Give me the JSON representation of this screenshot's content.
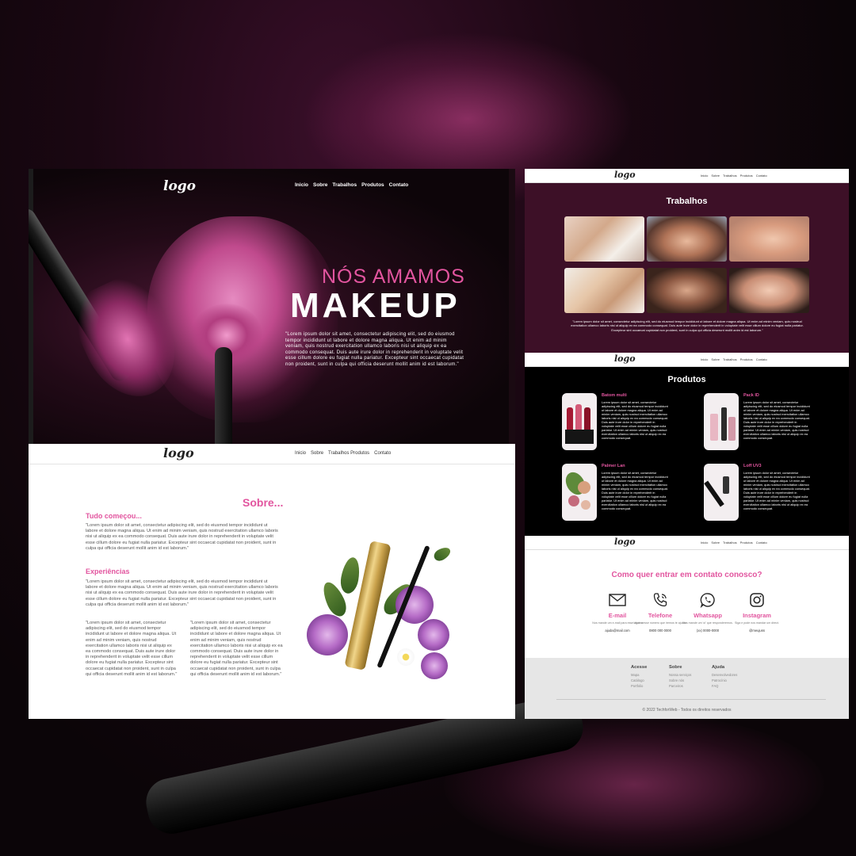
{
  "colors": {
    "accent": "#e2559f",
    "trabalhos_bg": "#3d1027",
    "produtos_bg": "#000000",
    "footer_bg": "#e6e6e6"
  },
  "hero": {
    "logo": "logo",
    "nav": [
      "Inicio",
      "Sobre",
      "Trabalhos",
      "Produtos",
      "Contato"
    ],
    "title_line1": "NÓS AMAMOS",
    "title_line2": "MAKEUP",
    "text": "\"Lorem ipsum dolor sit amet, consectetur adipiscing elit, sed do eiusmod tempor incididunt ut labore et dolore magna aliqua. Ut enim ad minim veniam, quis nostrud exercitation ullamco laboris nisi ut aliquip ex ea commodo consequat. Duis aute irure dolor in reprehenderit in voluptate velit esse cillum dolore eu fugiat nulla pariatur. Excepteur sint occaecat cupidatat non proident, sunt in culpa qui officia deserunt mollit anim id est laborum.\""
  },
  "navbar": {
    "logo": "logo",
    "links": [
      "Inicio",
      "Sobre",
      "Trabalhos Produtos",
      "Contato"
    ]
  },
  "sobre": {
    "title": "Sobre...",
    "heading1": "Tudo começou...",
    "para1": "\"Lorem ipsum dolor sit amet, consectetur adipiscing elit, sed do eiusmod tempor incididunt ut labore et dolore magna aliqua. Ut enim ad minim veniam, quis nostrud exercitation ullamco laboris nisi ut aliquip ex ea commodo consequat. Duis aute irure dolor in reprehenderit in voluptate velit esse cillum dolore eu fugiat nulla pariatur. Excepteur sint occaecat cupidatat non proident, sunt in culpa qui officia deserunt mollit anim id est laborum.\"",
    "heading2": "Experiências",
    "para2": "\"Lorem ipsum dolor sit amet, consectetur adipiscing elit, sed do eiusmod tempor incididunt ut labore et dolore magna aliqua. Ut enim ad minim veniam, quis nostrud exercitation ullamco laboris nisi ut aliquip ex ea commodo consequat. Duis aute irure dolor in reprehenderit in voluptate velit esse cillum dolore eu fugiat nulla pariatur. Excepteur sint occaecat cupidatat non proident, sunt in culpa qui officia deserunt mollit anim id est laborum.\"",
    "para3": "\"Lorem ipsum dolor sit amet, consectetur adipiscing elit, sed do eiusmod tempor incididunt ut labore et dolore magna aliqua. Ut enim ad minim veniam, quis nostrud exercitation ullamco laboris nisi ut aliquip ex ea commodo consequat. Duis aute irure dolor in reprehenderit in voluptate velit esse cillum dolore eu fugiat nulla pariatur. Excepteur sint occaecat cupidatat non proident, sunt in culpa qui officia deserunt mollit anim id est laborum.\"",
    "para4": "\"Lorem ipsum dolor sit amet, consectetur adipiscing elit, sed do eiusmod tempor incididunt ut labore et dolore magna aliqua. Ut enim ad minim veniam, quis nostrud exercitation ullamco laboris nisi ut aliquip ex ea commodo consequat. Duis aute irure dolor in reprehenderit in voluptate velit esse cillum dolore eu fugiat nulla pariatur. Excepteur sint occaecat cupidatat non proident, sunt in culpa qui officia deserunt mollit anim id est laborum.\""
  },
  "right_nav": {
    "logo": "logo",
    "links": [
      "Inicio",
      "Sobre",
      "Trabalhos",
      "Produtos",
      "Contato"
    ]
  },
  "trabalhos": {
    "title": "Trabalhos",
    "text": "\"Lorem ipsum dolor sit amet, consectetur adipiscing elit, sed do eiusmod tempor incididunt ut labore et dolore magna aliqua. Ut enim ad minim veniam, quis nostrud exercitation ullamco laboris nisi ut aliquip ex ea commodo consequat. Duis aute irure dolor in reprehenderit in voluptate velit esse cillum dolore eu fugiat nulla pariatur. Excepteur sint occaecat cupidatat non proident, sunt in culpa qui officia deserunt mollit anim id est laborum.\""
  },
  "produtos": {
    "title": "Produtos",
    "items": [
      {
        "name": "Batom multi",
        "desc": "Lorem ipsum dolor sit amet, consectetur adipiscing elit, sed do eiusmod tempor incididunt ut labore et dolore magna aliqua. Ut enim ad minim veniam, quis nostrud exercitation ullamco laboris nisi ut aliquip ex ea commodo consequat. Duis aute irure dolor in reprehenderit in voluptate velit esse cillum dolore eu fugiat nulla pariatur. Ut enim ad minim veniam, quis nostrud exercitation ullamco laboris nisi ut aliquip ex ea commodo consequat."
      },
      {
        "name": "Pack ID",
        "desc": "Lorem ipsum dolor sit amet, consectetur adipiscing elit, sed do eiusmod tempor incididunt ut labore et dolore magna aliqua. Ut enim ad minim veniam, quis nostrud exercitation ullamco laboris nisi ut aliquip ex ea commodo consequat. Duis aute irure dolor in reprehenderit in voluptate velit esse cillum dolore eu fugiat nulla pariatur. Ut enim ad minim veniam, quis nostrud exercitation ullamco laboris nisi ut aliquip ex ea commodo consequat."
      },
      {
        "name": "Palmer Lan",
        "desc": "Lorem ipsum dolor sit amet, consectetur adipiscing elit, sed do eiusmod tempor incididunt ut labore et dolore magna aliqua. Ut enim ad minim veniam, quis nostrud exercitation ullamco laboris nisi ut aliquip ex ea commodo consequat. Duis aute irure dolor in reprehenderit in voluptate velit esse cillum dolore eu fugiat nulla pariatur. Ut enim ad minim veniam, quis nostrud exercitation ullamco laboris nisi ut aliquip ex ea commodo consequat."
      },
      {
        "name": "Loff UV3",
        "desc": "Lorem ipsum dolor sit amet, consectetur adipiscing elit, sed do eiusmod tempor incididunt ut labore et dolore magna aliqua. Ut enim ad minim veniam, quis nostrud exercitation ullamco laboris nisi ut aliquip ex ea commodo consequat. Duis aute irure dolor in reprehenderit in voluptate velit esse cillum dolore eu fugiat nulla pariatur. Ut enim ad minim veniam, quis nostrud exercitation ullamco laboris nisi ut aliquip ex ea commodo consequat."
      }
    ]
  },
  "contato": {
    "title": "Como quer entrar em contato conosco?",
    "items": [
      {
        "label": "E-mail",
        "icon": "mail-icon",
        "desc": "Nos mande um e-mail para esse abaixo",
        "value": "ajuda@mail.com"
      },
      {
        "label": "Telefone",
        "icon": "phone-icon",
        "desc": "Ligue nesse número que iremos te ajudar.",
        "value": "0800 000 0000"
      },
      {
        "label": "Whatsapp",
        "icon": "whatsapp-icon",
        "desc": "Nos mande um 'oi' que responderemos.",
        "value": "(xx) 0000-0000"
      },
      {
        "label": "Instagram",
        "icon": "instagram-icon",
        "desc": "Siga e pode nos mandar um direct.",
        "value": "@meujuss"
      }
    ]
  },
  "footer": {
    "cols": [
      {
        "title": "Acesse",
        "links": [
          "Mapa",
          "Catálogo",
          "Portfolio"
        ]
      },
      {
        "title": "Sobre",
        "links": [
          "Nossa serviços",
          "Sobre nós",
          "Parceiros"
        ]
      },
      {
        "title": "Ajuda",
        "links": [
          "Desenvolvedores",
          "Patrocínio",
          "FAQ"
        ]
      }
    ],
    "copyright": "© 2022 TechforWeb -  Todos os direitos reservados"
  }
}
